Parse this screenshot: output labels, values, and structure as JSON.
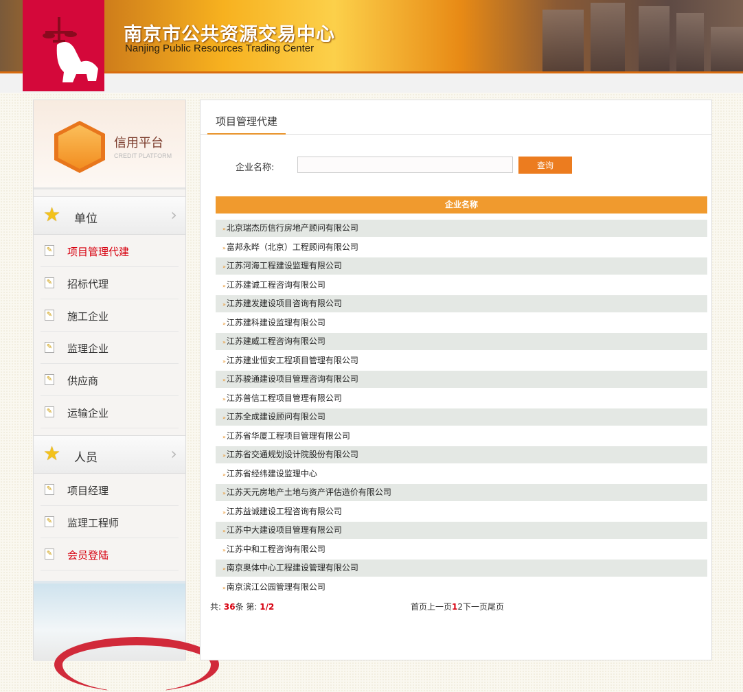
{
  "header": {
    "title_cn": "南京市公共资源交易中心",
    "title_en": "Nanjing Public Resources Trading Center"
  },
  "sidebar": {
    "platform_cn": "信用平台",
    "platform_en": "CREDIT PLATFORM",
    "groups": [
      {
        "label": "单位",
        "items": [
          "项目管理代建",
          "招标代理",
          "施工企业",
          "监理企业",
          "供应商",
          "运输企业"
        ]
      },
      {
        "label": "人员",
        "items": [
          "项目经理",
          "监理工程师",
          "会员登陆"
        ]
      }
    ]
  },
  "main": {
    "tab": "项目管理代建",
    "search_label": "企业名称:",
    "search_value": "",
    "search_button": "查询",
    "column": "企业名称",
    "rows": [
      "北京瑞杰历信行房地产顾问有限公司",
      "富邦永晔（北京）工程顾问有限公司",
      "江苏河海工程建设监理有限公司",
      "江苏建诚工程咨询有限公司",
      "江苏建发建设项目咨询有限公司",
      "江苏建科建设监理有限公司",
      "江苏建威工程咨询有限公司",
      "江苏建业恒安工程项目管理有限公司",
      "江苏骏通建设项目管理咨询有限公司",
      "江苏普信工程项目管理有限公司",
      "江苏全成建设顾问有限公司",
      "江苏省华厦工程项目管理有限公司",
      "江苏省交通规划设计院股份有限公司",
      "江苏省经纬建设监理中心",
      "江苏天元房地产土地与资产评估造价有限公司",
      "江苏益诚建设工程咨询有限公司",
      "江苏中大建设项目管理有限公司",
      "江苏中和工程咨询有限公司",
      "南京奥体中心工程建设管理有限公司",
      "南京滨江公园管理有限公司"
    ],
    "footer": {
      "total_prefix": "共:",
      "total": "36",
      "total_suffix": "条",
      "page_prefix": "第:",
      "page": "1/2",
      "first": "首页",
      "prev": "上一页",
      "page1": "1",
      "page2": "2",
      "next": "下一页",
      "last": "尾页"
    }
  }
}
